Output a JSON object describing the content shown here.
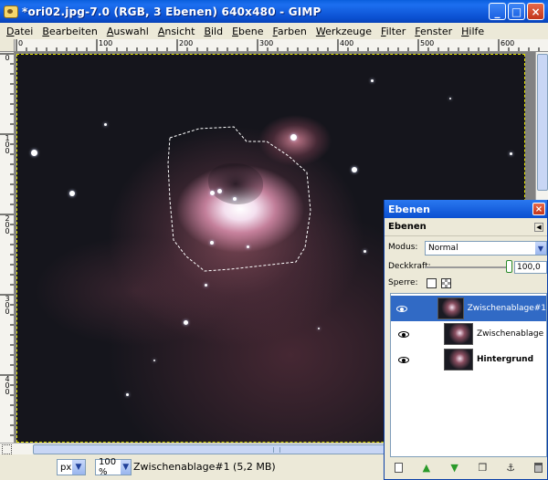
{
  "window": {
    "title": "*ori02.jpg-7.0 (RGB, 3 Ebenen) 640x480 - GIMP",
    "minimize_icon": "minimize-icon",
    "maximize_icon": "maximize-icon",
    "close_icon": "close-icon"
  },
  "menubar": {
    "items": [
      "Datei",
      "Bearbeiten",
      "Auswahl",
      "Ansicht",
      "Bild",
      "Ebene",
      "Farben",
      "Werkzeuge",
      "Filter",
      "Fenster",
      "Hilfe"
    ]
  },
  "ruler_top": {
    "labels": [
      "0",
      "100",
      "200",
      "300",
      "400",
      "500",
      "600"
    ]
  },
  "ruler_left": {
    "labels": [
      "0",
      "100",
      "200",
      "300",
      "400"
    ]
  },
  "statusbar": {
    "unit": "px",
    "zoom": "100 %",
    "message": "Zwischenablage#1 (5,2 MB)"
  },
  "layers_dialog": {
    "title": "Ebenen",
    "heading": "Ebenen",
    "mode_label": "Modus:",
    "mode_value": "Normal",
    "opacity_label": "Deckkraft:",
    "opacity_value": "100,0",
    "opacity_fraction": 1.0,
    "lock_label": "Sperre:",
    "layers": [
      {
        "name": "Zwischenablage#1",
        "selected": true,
        "bold": false
      },
      {
        "name": "Zwischenablage",
        "selected": false,
        "bold": false
      },
      {
        "name": "Hintergrund",
        "selected": false,
        "bold": true
      }
    ],
    "buttons": [
      "new-layer-icon",
      "raise-layer-icon",
      "lower-layer-icon",
      "duplicate-layer-icon",
      "anchor-layer-icon",
      "delete-layer-icon"
    ]
  },
  "colors": {
    "titlebar": "#0a4fd0",
    "selected_layer": "#316ac5",
    "nebula_core": "#f4e0ef",
    "sky": "#15151c"
  }
}
